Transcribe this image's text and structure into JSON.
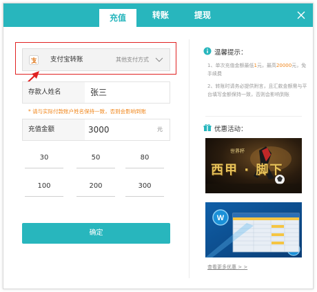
{
  "tabs": [
    {
      "label": "充值",
      "active": true
    },
    {
      "label": "转账",
      "active": false
    },
    {
      "label": "提现",
      "active": false
    }
  ],
  "payment_method": {
    "selected": "支付宝转账",
    "other_label": "其他支付方式",
    "icon": "alipay-icon"
  },
  "form": {
    "depositor_label": "存款人姓名",
    "depositor_value": "张三",
    "hint": "* 请与实际付款账户姓名保持一致，否则会影响到账",
    "amount_label": "充值金额",
    "amount_value": "3000",
    "amount_unit": "元"
  },
  "quick_amounts": [
    "30",
    "50",
    "80",
    "100",
    "200",
    "300"
  ],
  "confirm_label": "确定",
  "tips": {
    "title": "温馨提示：",
    "line1_a": "1、单次充值金额最低",
    "line1_min": "1",
    "line1_b": "元，最高",
    "line1_max": "20000",
    "line1_c": "元，免手续费",
    "line2": "2、转账时请务必提供附言，且汇款金额需与平台填写金额保持一致，否则会影响到账"
  },
  "promo": {
    "title": "优惠活动：",
    "banner1_text": "西甲 · 脚下",
    "banner1_small": "世界杯",
    "more_link": "查看更多优惠 > >"
  },
  "colors": {
    "accent": "#28b6bd",
    "highlight": "#f08519",
    "annotation": "#e02020"
  }
}
